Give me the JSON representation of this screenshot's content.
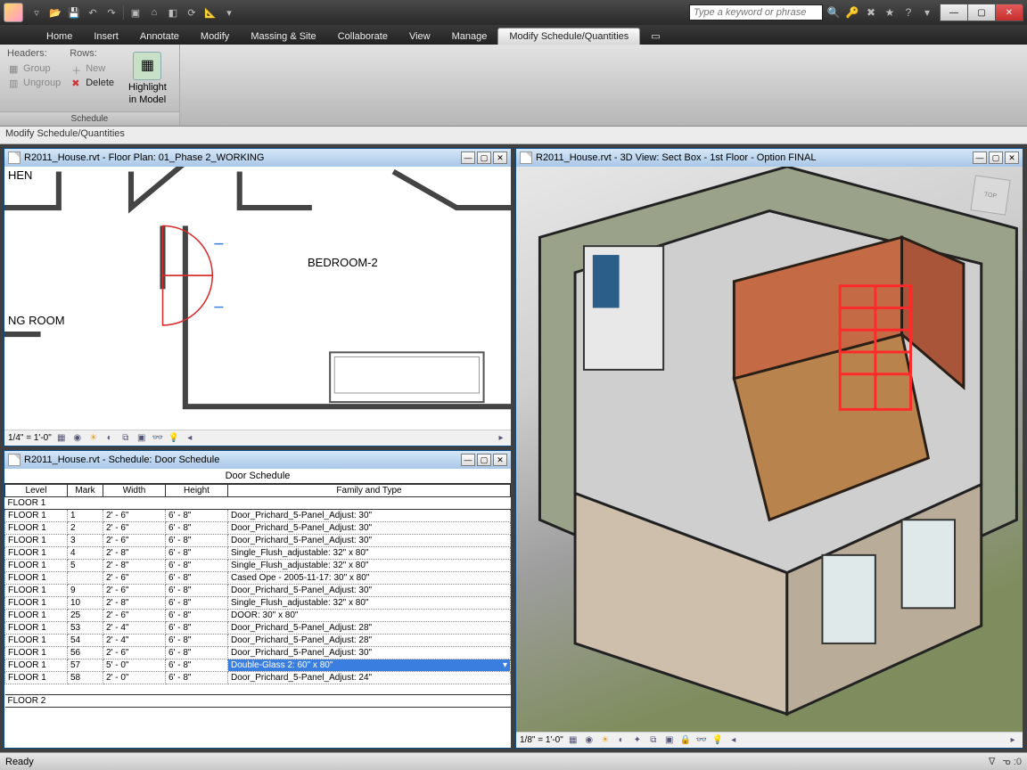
{
  "search": {
    "placeholder": "Type a keyword or phrase"
  },
  "menu_tabs": [
    "Home",
    "Insert",
    "Annotate",
    "Modify",
    "Massing & Site",
    "Collaborate",
    "View",
    "Manage",
    "Modify Schedule/Quantities"
  ],
  "active_tab": "Modify Schedule/Quantities",
  "ribbon": {
    "group_label": "Schedule",
    "headers_title": "Headers:",
    "rows_title": "Rows:",
    "group_btn": "Group",
    "ungroup_btn": "Ungroup",
    "new_btn": "New",
    "delete_btn": "Delete",
    "highlight_btn_l1": "Highlight",
    "highlight_btn_l2": "in Model"
  },
  "options_bar": "Modify Schedule/Quantities",
  "panes": {
    "floorplan": {
      "title": "R2011_House.rvt - Floor Plan: 01_Phase 2_WORKING",
      "scale": "1/4\" = 1'-0\"",
      "labels": {
        "bedroom": "BEDROOM-2",
        "kitchen": "HEN",
        "living": "NG ROOM"
      }
    },
    "view3d": {
      "title": "R2011_House.rvt - 3D View: Sect Box - 1st Floor - Option FINAL",
      "scale": "1/8\" = 1'-0\"",
      "viewcube": "TOP"
    },
    "schedule": {
      "title": "R2011_House.rvt - Schedule: Door Schedule",
      "heading": "Door Schedule",
      "cols": [
        "Level",
        "Mark",
        "Width",
        "Height",
        "Family and Type"
      ],
      "group1": "FLOOR 1",
      "group2": "FLOOR 2",
      "rows": [
        [
          "FLOOR 1",
          "1",
          "2' - 6\"",
          "6' - 8\"",
          "Door_Prichard_5-Panel_Adjust: 30\""
        ],
        [
          "FLOOR 1",
          "2",
          "2' - 6\"",
          "6' - 8\"",
          "Door_Prichard_5-Panel_Adjust: 30\""
        ],
        [
          "FLOOR 1",
          "3",
          "2' - 6\"",
          "6' - 8\"",
          "Door_Prichard_5-Panel_Adjust: 30\""
        ],
        [
          "FLOOR 1",
          "4",
          "2' - 8\"",
          "6' - 8\"",
          "Single_Flush_adjustable: 32\" x 80\""
        ],
        [
          "FLOOR 1",
          "5",
          "2' - 8\"",
          "6' - 8\"",
          "Single_Flush_adjustable: 32\" x 80\""
        ],
        [
          "FLOOR 1",
          "",
          "2' - 6\"",
          "6' - 8\"",
          "Cased Ope - 2005-11-17: 30\" x 80\""
        ],
        [
          "FLOOR 1",
          "9",
          "2' - 6\"",
          "6' - 8\"",
          "Door_Prichard_5-Panel_Adjust: 30\""
        ],
        [
          "FLOOR 1",
          "10",
          "2' - 8\"",
          "6' - 8\"",
          "Single_Flush_adjustable: 32\" x 80\""
        ],
        [
          "FLOOR 1",
          "25",
          "2' - 6\"",
          "6' - 8\"",
          "DOOR: 30\" x 80\""
        ],
        [
          "FLOOR 1",
          "53",
          "2' - 4\"",
          "6' - 8\"",
          "Door_Prichard_5-Panel_Adjust: 28\""
        ],
        [
          "FLOOR 1",
          "54",
          "2' - 4\"",
          "6' - 8\"",
          "Door_Prichard_5-Panel_Adjust: 28\""
        ],
        [
          "FLOOR 1",
          "56",
          "2' - 6\"",
          "6' - 8\"",
          "Door_Prichard_5-Panel_Adjust: 30\""
        ],
        [
          "FLOOR 1",
          "57",
          "5' - 0\"",
          "6' - 8\"",
          "Double-Glass 2: 60\" x 80\""
        ],
        [
          "FLOOR 1",
          "58",
          "2' - 0\"",
          "6' - 8\"",
          "Door_Prichard_5-Panel_Adjust: 24\""
        ]
      ],
      "selected_row_index": 12
    }
  },
  "status": {
    "left": "Ready",
    "press": "0",
    "filter": ""
  }
}
